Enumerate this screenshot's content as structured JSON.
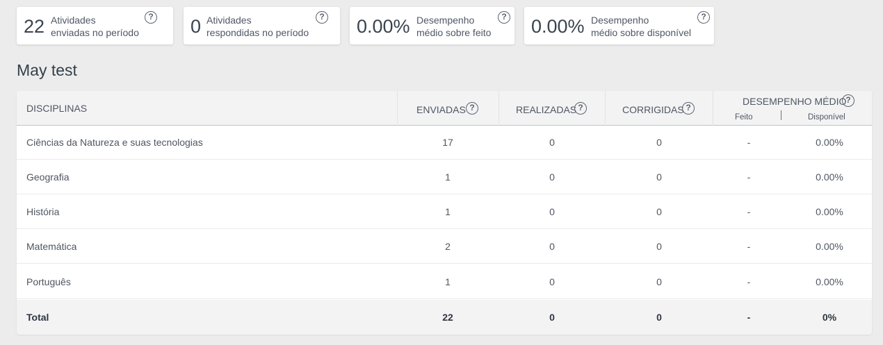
{
  "summary_cards": [
    {
      "value": "22",
      "label_line1": "Atividades",
      "label_line2": "enviadas no período"
    },
    {
      "value": "0",
      "label_line1": "Atividades",
      "label_line2": "respondidas no período"
    },
    {
      "value": "0.00%",
      "label_line1": "Desempenho",
      "label_line2": "médio sobre feito"
    },
    {
      "value": "0.00%",
      "label_line1": "Desempenho",
      "label_line2": "médio sobre disponível"
    }
  ],
  "section_title": "May test",
  "table": {
    "headers": {
      "disciplinas": "DISCIPLINAS",
      "enviadas": "ENVIADAS",
      "realizadas": "REALIZADAS",
      "corrigidas": "CORRIGIDAS",
      "desempenho": "DESEMPENHO MÉDIO",
      "feito": "Feito",
      "disponivel": "Disponível"
    },
    "rows": [
      {
        "disciplina": "Ciências da Natureza e suas tecnologias",
        "enviadas": "17",
        "realizadas": "0",
        "corrigidas": "0",
        "feito": "-",
        "disponivel": "0.00%"
      },
      {
        "disciplina": "Geografia",
        "enviadas": "1",
        "realizadas": "0",
        "corrigidas": "0",
        "feito": "-",
        "disponivel": "0.00%"
      },
      {
        "disciplina": "História",
        "enviadas": "1",
        "realizadas": "0",
        "corrigidas": "0",
        "feito": "-",
        "disponivel": "0.00%"
      },
      {
        "disciplina": "Matemática",
        "enviadas": "2",
        "realizadas": "0",
        "corrigidas": "0",
        "feito": "-",
        "disponivel": "0.00%"
      },
      {
        "disciplina": "Português",
        "enviadas": "1",
        "realizadas": "0",
        "corrigidas": "0",
        "feito": "-",
        "disponivel": "0.00%"
      }
    ],
    "total": {
      "label": "Total",
      "enviadas": "22",
      "realizadas": "0",
      "corrigidas": "0",
      "feito": "-",
      "disponivel": "0%"
    }
  },
  "help_icon": {
    "icon": "question-circle-icon",
    "glyph": "?"
  }
}
